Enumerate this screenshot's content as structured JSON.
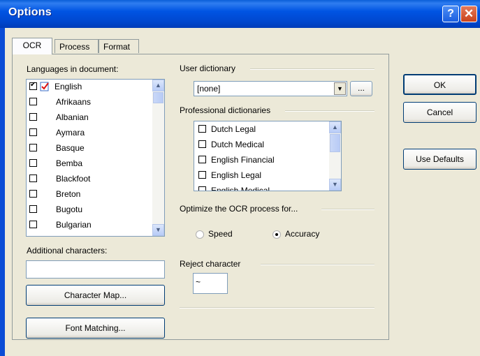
{
  "window": {
    "title": "Options",
    "help_glyph": "?",
    "close_glyph": "✕"
  },
  "tabs": [
    {
      "label": "OCR",
      "active": true
    },
    {
      "label": "Process",
      "active": false
    },
    {
      "label": "Format",
      "active": false
    }
  ],
  "languages": {
    "label": "Languages in document:",
    "items": [
      {
        "name": "English",
        "checked": true
      },
      {
        "name": "Afrikaans",
        "checked": false
      },
      {
        "name": "Albanian",
        "checked": false
      },
      {
        "name": "Aymara",
        "checked": false
      },
      {
        "name": "Basque",
        "checked": false
      },
      {
        "name": "Bemba",
        "checked": false
      },
      {
        "name": "Blackfoot",
        "checked": false
      },
      {
        "name": "Breton",
        "checked": false
      },
      {
        "name": "Bugotu",
        "checked": false
      },
      {
        "name": "Bulgarian",
        "checked": false
      }
    ]
  },
  "additional_characters": {
    "label": "Additional characters:",
    "value": ""
  },
  "buttons": {
    "character_map": "Character Map...",
    "font_matching": "Font Matching...",
    "ok": "OK",
    "cancel": "Cancel",
    "use_defaults": "Use Defaults",
    "browse": "..."
  },
  "user_dictionary": {
    "label": "User dictionary",
    "value": "[none]"
  },
  "professional_dictionaries": {
    "label": "Professional dictionaries",
    "items": [
      {
        "name": "Dutch Legal",
        "checked": false
      },
      {
        "name": "Dutch Medical",
        "checked": false
      },
      {
        "name": "English Financial",
        "checked": false
      },
      {
        "name": "English Legal",
        "checked": false
      },
      {
        "name": "English Medical",
        "checked": false
      }
    ]
  },
  "optimize": {
    "label": "Optimize the OCR process for...",
    "options": [
      {
        "label": "Speed",
        "selected": false
      },
      {
        "label": "Accuracy",
        "selected": true
      }
    ]
  },
  "reject_character": {
    "label": "Reject character",
    "value": "~"
  },
  "colors": {
    "title_bar": "#0054e3",
    "dialog_face": "#ece9d8",
    "input_border": "#7f9db9"
  }
}
